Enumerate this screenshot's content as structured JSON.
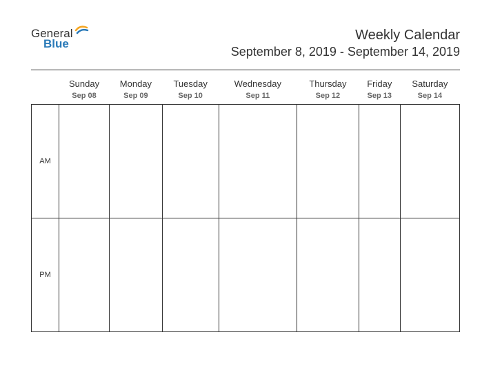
{
  "logo": {
    "line1": "General",
    "line2": "Blue"
  },
  "header": {
    "title": "Weekly Calendar",
    "subtitle": "September 8, 2019 - September 14, 2019"
  },
  "days": [
    {
      "name": "Sunday",
      "date": "Sep 08"
    },
    {
      "name": "Monday",
      "date": "Sep 09"
    },
    {
      "name": "Tuesday",
      "date": "Sep 10"
    },
    {
      "name": "Wednesday",
      "date": "Sep 11"
    },
    {
      "name": "Thursday",
      "date": "Sep 12"
    },
    {
      "name": "Friday",
      "date": "Sep 13"
    },
    {
      "name": "Saturday",
      "date": "Sep 14"
    }
  ],
  "periods": {
    "am": "AM",
    "pm": "PM"
  }
}
